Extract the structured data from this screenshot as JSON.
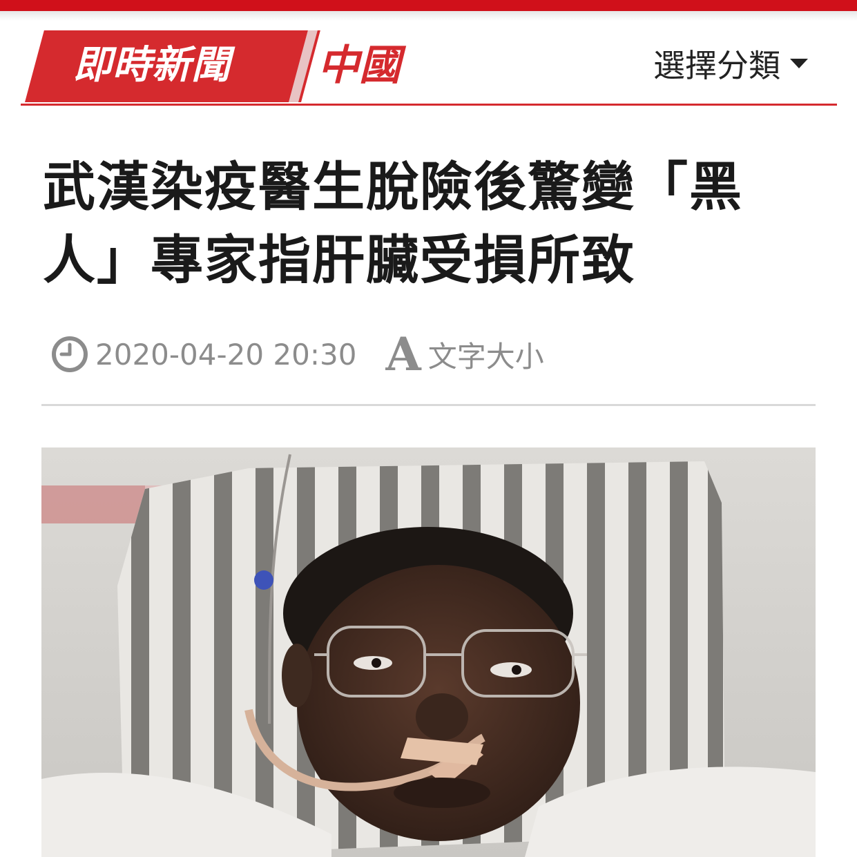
{
  "section": {
    "tag": "即時新聞",
    "category": "中國",
    "select_label": "選擇分類"
  },
  "article": {
    "headline": "武漢染疫醫生脫險後驚變「黑人」專家指肝臟受損所致",
    "date": "2020-04-20 20:30",
    "font_size_label": "文字大小",
    "font_icon_glyph": "A"
  },
  "colors": {
    "brand_red": "#d0101a",
    "tag_red": "#d52a2e",
    "meta_gray": "#8c8c8c"
  },
  "icons": {
    "clock": "clock-icon",
    "font_size": "font-size-icon",
    "dropdown": "chevron-down-icon"
  }
}
